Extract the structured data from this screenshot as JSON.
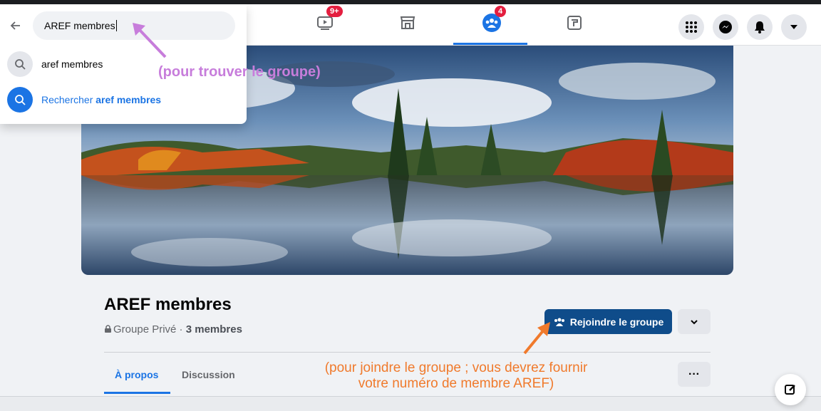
{
  "search": {
    "query": "AREF membres",
    "suggestion": "aref membres",
    "search_prefix": "Rechercher ",
    "search_bold": "aref membres"
  },
  "nav": {
    "watch_badge": "9+",
    "groups_badge": "4"
  },
  "group": {
    "name": "AREF membres",
    "privacy": "Groupe Privé · ",
    "members": "3 membres",
    "join_label": "Rejoindre le groupe"
  },
  "tabs": [
    "À propos",
    "Discussion"
  ],
  "more_label": "···",
  "annotations": {
    "search_hint": "(pour trouver le groupe)",
    "join_hint_line1": "(pour joindre le groupe ; vous devrez fournir",
    "join_hint_line2": "votre numéro de membre AREF)"
  },
  "colors": {
    "accent": "#1b74e4",
    "join_button": "#0f4c8a",
    "annotation_search": "#c77ddb",
    "annotation_join": "#f07a2c"
  }
}
